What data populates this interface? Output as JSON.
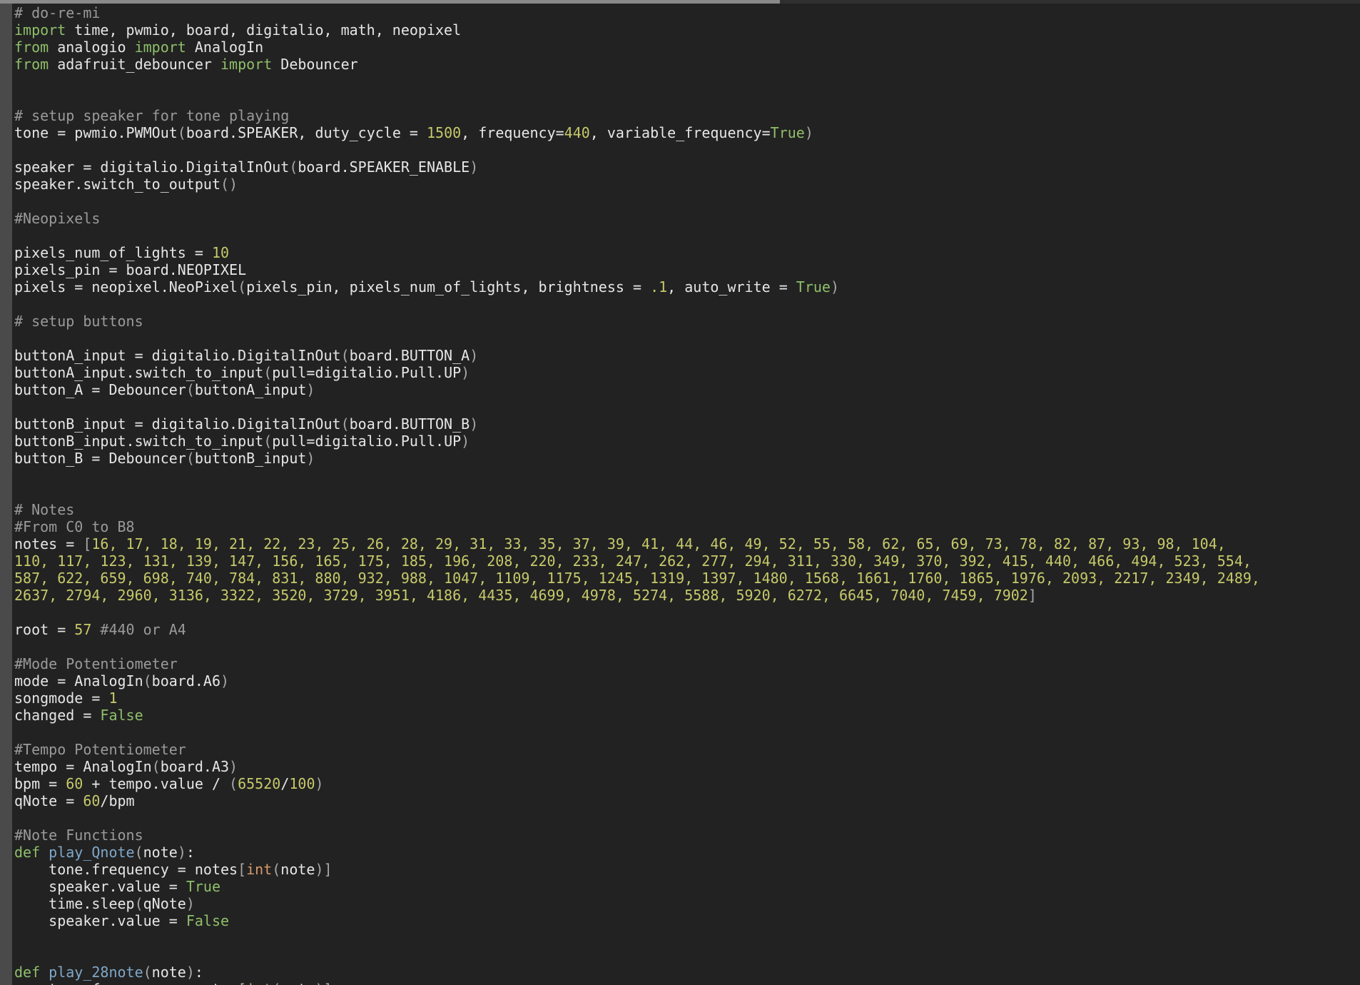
{
  "editor": {
    "lines": [
      [
        [
          "comment",
          "# do-re-mi"
        ]
      ],
      [
        [
          "keyword",
          "import"
        ],
        [
          "default",
          " time, pwmio, board, digitalio, math, neopixel"
        ]
      ],
      [
        [
          "keyword",
          "from"
        ],
        [
          "default",
          " analogio "
        ],
        [
          "keyword",
          "import"
        ],
        [
          "default",
          " AnalogIn"
        ]
      ],
      [
        [
          "keyword",
          "from"
        ],
        [
          "default",
          " adafruit_debouncer "
        ],
        [
          "keyword",
          "import"
        ],
        [
          "default",
          " Debouncer"
        ]
      ],
      [],
      [],
      [
        [
          "comment",
          "# setup speaker for tone playing"
        ]
      ],
      [
        [
          "default",
          "tone = pwmio.PWMOut"
        ],
        [
          "punct",
          "("
        ],
        [
          "default",
          "board.SPEAKER, duty_cycle = "
        ],
        [
          "number",
          "1500"
        ],
        [
          "default",
          ", frequency="
        ],
        [
          "number",
          "440"
        ],
        [
          "default",
          ", variable_frequency="
        ],
        [
          "const",
          "True"
        ],
        [
          "punct",
          ")"
        ]
      ],
      [],
      [
        [
          "default",
          "speaker = digitalio.DigitalInOut"
        ],
        [
          "punct",
          "("
        ],
        [
          "default",
          "board.SPEAKER_ENABLE"
        ],
        [
          "punct",
          ")"
        ]
      ],
      [
        [
          "default",
          "speaker.switch_to_output"
        ],
        [
          "punct",
          "()"
        ]
      ],
      [],
      [
        [
          "comment",
          "#Neopixels"
        ]
      ],
      [],
      [
        [
          "default",
          "pixels_num_of_lights = "
        ],
        [
          "number",
          "10"
        ]
      ],
      [
        [
          "default",
          "pixels_pin = board.NEOPIXEL"
        ]
      ],
      [
        [
          "default",
          "pixels = neopixel.NeoPixel"
        ],
        [
          "punct",
          "("
        ],
        [
          "default",
          "pixels_pin, pixels_num_of_lights, brightness = "
        ],
        [
          "number",
          ".1"
        ],
        [
          "default",
          ", auto_write = "
        ],
        [
          "const",
          "True"
        ],
        [
          "punct",
          ")"
        ]
      ],
      [],
      [
        [
          "comment",
          "# setup buttons"
        ]
      ],
      [],
      [
        [
          "default",
          "buttonA_input = digitalio.DigitalInOut"
        ],
        [
          "punct",
          "("
        ],
        [
          "default",
          "board.BUTTON_A"
        ],
        [
          "punct",
          ")"
        ]
      ],
      [
        [
          "default",
          "buttonA_input.switch_to_input"
        ],
        [
          "punct",
          "("
        ],
        [
          "default",
          "pull=digitalio.Pull.UP"
        ],
        [
          "punct",
          ")"
        ]
      ],
      [
        [
          "default",
          "button_A = Debouncer"
        ],
        [
          "punct",
          "("
        ],
        [
          "default",
          "buttonA_input"
        ],
        [
          "punct",
          ")"
        ]
      ],
      [],
      [
        [
          "default",
          "buttonB_input = digitalio.DigitalInOut"
        ],
        [
          "punct",
          "("
        ],
        [
          "default",
          "board.BUTTON_B"
        ],
        [
          "punct",
          ")"
        ]
      ],
      [
        [
          "default",
          "buttonB_input.switch_to_input"
        ],
        [
          "punct",
          "("
        ],
        [
          "default",
          "pull=digitalio.Pull.UP"
        ],
        [
          "punct",
          ")"
        ]
      ],
      [
        [
          "default",
          "button_B = Debouncer"
        ],
        [
          "punct",
          "("
        ],
        [
          "default",
          "buttonB_input"
        ],
        [
          "punct",
          ")"
        ]
      ],
      [],
      [],
      [
        [
          "comment",
          "# Notes"
        ]
      ],
      [
        [
          "comment",
          "#From C0 to B8"
        ]
      ],
      [
        [
          "default",
          "notes = "
        ],
        [
          "punct",
          "["
        ],
        [
          "number",
          "16, 17, 18, 19, 21, 22, 23, 25, 26, 28, 29, 31, 33, 35, 37, 39, 41, 44, 46, 49, 52, 55, 58, 62, 65, 69, 73, 78, 82, 87, 93, 98, 104,"
        ]
      ],
      [
        [
          "number",
          "110, 117, 123, 131, 139, 147, 156, 165, 175, 185, 196, 208, 220, 233, 247, 262, 277, 294, 311, 330, 349, 370, 392, 415, 440, 466, 494, 523, 554,"
        ]
      ],
      [
        [
          "number",
          "587, 622, 659, 698, 740, 784, 831, 880, 932, 988, 1047, 1109, 1175, 1245, 1319, 1397, 1480, 1568, 1661, 1760, 1865, 1976, 2093, 2217, 2349, 2489,"
        ]
      ],
      [
        [
          "number",
          "2637, 2794, 2960, 3136, 3322, 3520, 3729, 3951, 4186, 4435, 4699, 4978, 5274, 5588, 5920, 6272, 6645, 7040, 7459, 7902"
        ],
        [
          "punct",
          "]"
        ]
      ],
      [],
      [
        [
          "default",
          "root = "
        ],
        [
          "number",
          "57"
        ],
        [
          "comment",
          " #440 or A4"
        ]
      ],
      [],
      [
        [
          "comment",
          "#Mode Potentiometer"
        ]
      ],
      [
        [
          "default",
          "mode = AnalogIn"
        ],
        [
          "punct",
          "("
        ],
        [
          "default",
          "board.A6"
        ],
        [
          "punct",
          ")"
        ]
      ],
      [
        [
          "default",
          "songmode = "
        ],
        [
          "number",
          "1"
        ]
      ],
      [
        [
          "default",
          "changed = "
        ],
        [
          "const",
          "False"
        ]
      ],
      [],
      [
        [
          "comment",
          "#Tempo Potentiometer"
        ]
      ],
      [
        [
          "default",
          "tempo = AnalogIn"
        ],
        [
          "punct",
          "("
        ],
        [
          "default",
          "board.A3"
        ],
        [
          "punct",
          ")"
        ]
      ],
      [
        [
          "default",
          "bpm = "
        ],
        [
          "number",
          "60"
        ],
        [
          "default",
          " + tempo.value / "
        ],
        [
          "punct",
          "("
        ],
        [
          "number",
          "65520"
        ],
        [
          "default",
          "/"
        ],
        [
          "number",
          "100"
        ],
        [
          "punct",
          ")"
        ]
      ],
      [
        [
          "default",
          "qNote = "
        ],
        [
          "number",
          "60"
        ],
        [
          "default",
          "/bpm"
        ]
      ],
      [],
      [
        [
          "comment",
          "#Note Functions"
        ]
      ],
      [
        [
          "keyword",
          "def"
        ],
        [
          "default",
          " "
        ],
        [
          "func",
          "play_Qnote"
        ],
        [
          "punct",
          "("
        ],
        [
          "default",
          "note"
        ],
        [
          "punct",
          ")"
        ],
        [
          "default",
          ":"
        ]
      ],
      [
        [
          "default",
          "    tone.frequency = notes"
        ],
        [
          "punct",
          "["
        ],
        [
          "builtin",
          "int"
        ],
        [
          "punct",
          "("
        ],
        [
          "default",
          "note"
        ],
        [
          "punct",
          ")]"
        ]
      ],
      [
        [
          "default",
          "    speaker.value = "
        ],
        [
          "const",
          "True"
        ]
      ],
      [
        [
          "default",
          "    time.sleep"
        ],
        [
          "punct",
          "("
        ],
        [
          "default",
          "qNote"
        ],
        [
          "punct",
          ")"
        ]
      ],
      [
        [
          "default",
          "    speaker.value = "
        ],
        [
          "const",
          "False"
        ]
      ],
      [],
      [],
      [
        [
          "keyword",
          "def"
        ],
        [
          "default",
          " "
        ],
        [
          "func",
          "play_28note"
        ],
        [
          "punct",
          "("
        ],
        [
          "default",
          "note"
        ],
        [
          "punct",
          ")"
        ],
        [
          "default",
          ":"
        ]
      ],
      [
        [
          "default",
          "    tone.frequency = notes"
        ],
        [
          "punct",
          "["
        ],
        [
          "builtin",
          "int"
        ],
        [
          "punct",
          "("
        ],
        [
          "default",
          "note"
        ],
        [
          "punct",
          ")]"
        ]
      ]
    ]
  },
  "colors": {
    "background": "#222222",
    "gutter": "#4a4a4a",
    "default_text": "#e6e6e6",
    "comment": "#9a9a9a",
    "keyword": "#8fbf6a",
    "number": "#c6c96a",
    "function_name": "#7fa7c9"
  }
}
